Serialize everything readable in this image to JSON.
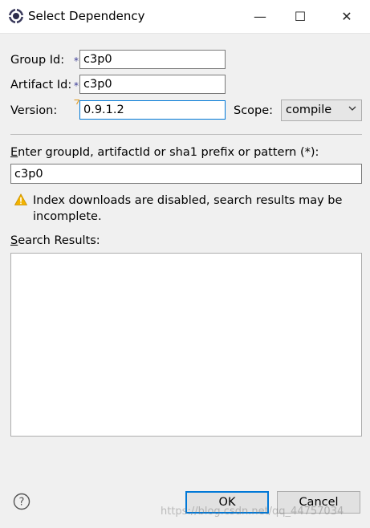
{
  "window": {
    "title": "Select Dependency",
    "minimize_glyph": "—",
    "maximize_glyph": "☐",
    "close_glyph": "✕"
  },
  "form": {
    "group_id_label": "Group Id:",
    "group_id_value": "c3p0",
    "artifact_id_label": "Artifact Id:",
    "artifact_id_value": "c3p0",
    "version_label": "Version:",
    "version_value": "0.9.1.2",
    "scope_label": "Scope:",
    "scope_value": "compile",
    "required_marker": "*"
  },
  "search": {
    "label_first": "E",
    "label_rest": "nter groupId, artifactId or sha1 prefix or pattern (*):",
    "value": "c3p0",
    "warning_line1": "Index downloads are disabled, search results may be",
    "warning_line2": "incomplete.",
    "results_label_first": "S",
    "results_label_rest": "earch Results:"
  },
  "buttons": {
    "ok": "OK",
    "cancel": "Cancel"
  },
  "watermark": "https://blog.csdn.net/qq_44757034",
  "colors": {
    "accent": "#0078d7",
    "warning": "#f2b300"
  },
  "icons": {
    "app": "eclipse-gear-icon",
    "warning": "warning-icon",
    "help": "help-icon",
    "dropdown": "chevron-down-icon"
  }
}
